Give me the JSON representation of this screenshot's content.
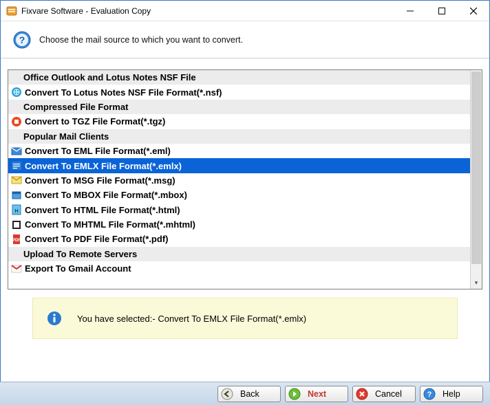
{
  "window": {
    "title": "Fixvare Software - Evaluation Copy"
  },
  "instruction": "Choose the mail source to which you want to convert.",
  "list": [
    {
      "kind": "header",
      "label": "Office Outlook and Lotus Notes NSF File"
    },
    {
      "kind": "item",
      "icon": "nsf",
      "label": "Convert To Lotus Notes NSF File Format(*.nsf)"
    },
    {
      "kind": "header",
      "label": "Compressed File Format"
    },
    {
      "kind": "item",
      "icon": "tgz",
      "label": "Convert to TGZ File Format(*.tgz)"
    },
    {
      "kind": "header",
      "label": "Popular Mail Clients"
    },
    {
      "kind": "item",
      "icon": "eml",
      "label": "Convert To EML File Format(*.eml)"
    },
    {
      "kind": "item",
      "icon": "emlx",
      "label": "Convert To EMLX File Format(*.emlx)",
      "selected": true
    },
    {
      "kind": "item",
      "icon": "msg",
      "label": "Convert To MSG File Format(*.msg)"
    },
    {
      "kind": "item",
      "icon": "mbox",
      "label": "Convert To MBOX File Format(*.mbox)"
    },
    {
      "kind": "item",
      "icon": "html",
      "label": "Convert To HTML File Format(*.html)"
    },
    {
      "kind": "item",
      "icon": "mhtml",
      "label": "Convert To MHTML File Format(*.mhtml)"
    },
    {
      "kind": "item",
      "icon": "pdf",
      "label": "Convert To PDF File Format(*.pdf)"
    },
    {
      "kind": "header",
      "label": "Upload To Remote Servers"
    },
    {
      "kind": "item",
      "icon": "gmail",
      "label": "Export To Gmail Account"
    }
  ],
  "info": {
    "text": "You have selected:- Convert To EMLX File Format(*.emlx)"
  },
  "buttons": {
    "back": "Back",
    "next": "Next",
    "cancel": "Cancel",
    "help": "Help"
  }
}
